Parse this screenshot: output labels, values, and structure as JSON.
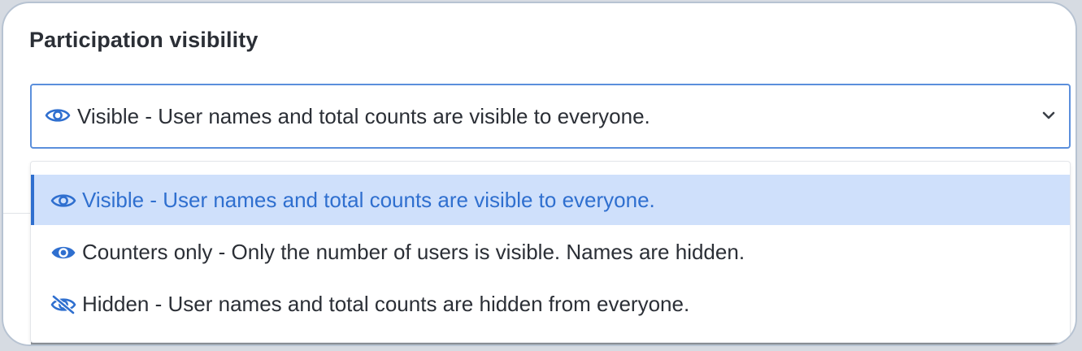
{
  "title": "Participation visibility",
  "select": {
    "selected_label": "Visible - User names and total counts are visible to everyone.",
    "selected_icon": "eye-outline-icon",
    "expanded_icon": "chevron-down-icon"
  },
  "options": [
    {
      "label": "Visible - User names and total counts are visible to everyone.",
      "icon": "eye-outline-icon",
      "selected": true
    },
    {
      "label": "Counters only - Only the number of users is visible. Names are hidden.",
      "icon": "eye-filled-icon",
      "selected": false
    },
    {
      "label": "Hidden - User names and total counts are hidden from everyone.",
      "icon": "eye-off-icon",
      "selected": false
    }
  ],
  "colors": {
    "accent": "#2f6fcf",
    "selected_bg": "#cfe0fb",
    "text": "#2b2f36",
    "focus_border": "#5b8fdc"
  }
}
